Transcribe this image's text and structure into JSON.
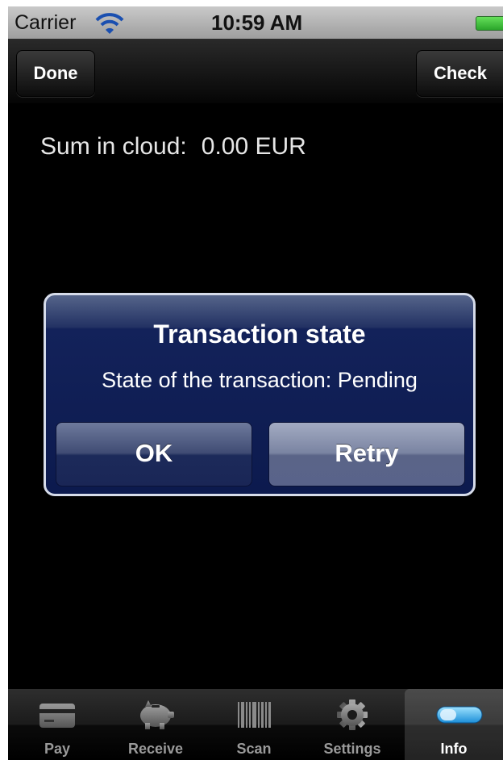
{
  "status_bar": {
    "carrier": "Carrier",
    "time": "10:59 AM"
  },
  "nav_bar": {
    "left_button": "Done",
    "right_button": "Check"
  },
  "content": {
    "sum_label": "Sum in cloud:",
    "sum_value": "0.00 EUR"
  },
  "alert": {
    "title": "Transaction state",
    "message": "State of the transaction: Pending",
    "buttons": [
      "OK",
      "Retry"
    ]
  },
  "tab_bar": {
    "tabs": [
      {
        "label": "Pay",
        "icon": "credit-card-icon"
      },
      {
        "label": "Receive",
        "icon": "piggy-bank-icon"
      },
      {
        "label": "Scan",
        "icon": "barcode-icon"
      },
      {
        "label": "Settings",
        "icon": "gear-icon"
      },
      {
        "label": "Info",
        "icon": "capsule-icon"
      }
    ],
    "selected": "Info"
  },
  "colors": {
    "alert_background": "#0c1a4e",
    "battery": "#3cc83c"
  }
}
